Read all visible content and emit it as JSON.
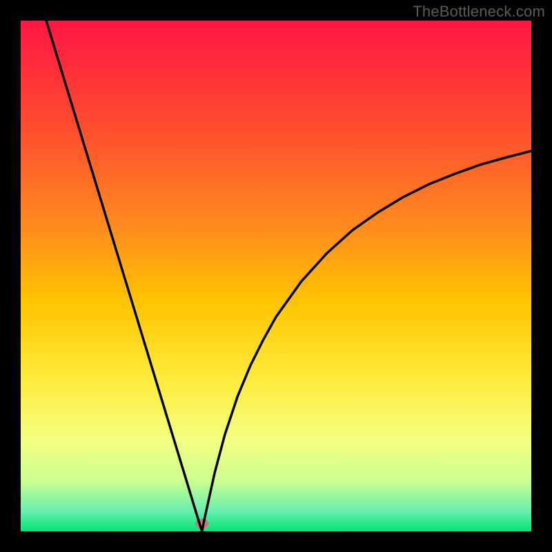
{
  "watermark": "TheBottleneck.com",
  "chart_data": {
    "type": "line",
    "title": "",
    "xlabel": "",
    "ylabel": "",
    "xlim": [
      0,
      100
    ],
    "ylim": [
      0,
      100
    ],
    "grid": false,
    "legend": false,
    "background_gradient": {
      "stops": [
        {
          "pos": 0.0,
          "color": "#ff1744"
        },
        {
          "pos": 0.2,
          "color": "#ff4a2f"
        },
        {
          "pos": 0.4,
          "color": "#ff8a1f"
        },
        {
          "pos": 0.55,
          "color": "#ffc400"
        },
        {
          "pos": 0.7,
          "color": "#ffeb3b"
        },
        {
          "pos": 0.82,
          "color": "#f4ff81"
        },
        {
          "pos": 0.9,
          "color": "#ccff90"
        },
        {
          "pos": 0.96,
          "color": "#69f0ae"
        },
        {
          "pos": 1.0,
          "color": "#00e676"
        }
      ]
    },
    "annotations": [
      {
        "type": "ellipse",
        "x": 35.5,
        "y": 1.5,
        "rx": 1.3,
        "ry": 1.0,
        "color": "#c97a7a"
      }
    ],
    "series": [
      {
        "name": "curve",
        "color": "#000000",
        "x": [
          5.0,
          7.5,
          10.0,
          12.5,
          15.0,
          17.5,
          20.0,
          22.5,
          25.0,
          27.5,
          30.0,
          32.5,
          33.5,
          34.5,
          35.0,
          35.5,
          36.0,
          37.0,
          38.0,
          40.0,
          42.5,
          45.0,
          47.5,
          50.0,
          55.0,
          60.0,
          65.0,
          70.0,
          75.0,
          80.0,
          85.0,
          90.0,
          95.0,
          100.0
        ],
        "y": [
          100.0,
          91.8,
          83.6,
          75.4,
          67.2,
          59.0,
          50.8,
          42.6,
          34.4,
          26.2,
          18.0,
          9.8,
          6.5,
          3.2,
          1.6,
          0.0,
          2.5,
          7.0,
          11.5,
          19.0,
          26.5,
          32.5,
          37.5,
          42.0,
          49.0,
          54.5,
          59.0,
          62.5,
          65.5,
          68.0,
          70.0,
          71.8,
          73.2,
          74.5
        ]
      }
    ]
  }
}
